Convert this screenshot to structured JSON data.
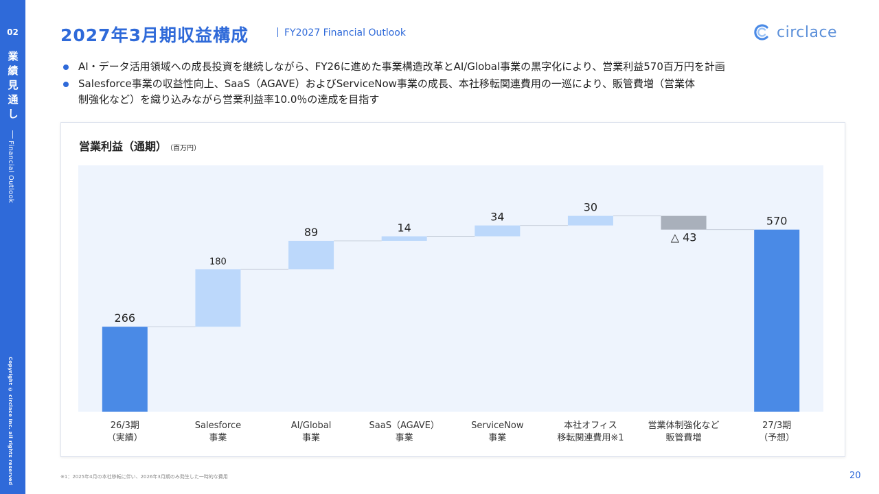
{
  "sidebar": {
    "section_number": "02",
    "section_title": "業績見通し",
    "section_subtitle": "Financial Outlook",
    "copyright": "Copyright © circlace Inc. all rights reserved"
  },
  "header": {
    "title": "2027年3月期収益構成",
    "subtitle": "FY2027 Financial Outlook",
    "logo_text": "circlace"
  },
  "bullets": [
    "AI・データ活用領域への成長投資を継続しながら、FY26に進めた事業構造改革とAI/Global事業の黒字化により、営業利益570百万円を計画",
    "Salesforce事業の収益性向上、SaaS（AGAVE）およびServiceNow事業の成長、本社移転関連費用の一巡により、販管費増（営業体制強化など）を織り込みながら営業利益率10.0％の達成を目指す"
  ],
  "chart_title": "営業利益（通期）",
  "chart_unit": "（百万円）",
  "chart_data": {
    "type": "waterfall",
    "categories": [
      [
        "26/3期",
        "（実績）"
      ],
      [
        "Salesforce",
        "事業"
      ],
      [
        "AI/Global",
        "事業"
      ],
      [
        "SaaS（AGAVE）",
        "事業"
      ],
      [
        "ServiceNow",
        "事業"
      ],
      [
        "本社オフィス",
        "移転関連費用※1"
      ],
      [
        "営業体制強化など",
        "販管費増"
      ],
      [
        "27/3期",
        "（予想）"
      ]
    ],
    "values": [
      266,
      180,
      89,
      14,
      34,
      30,
      -43,
      570
    ],
    "labels": [
      "266",
      "180",
      "89",
      "14",
      "34",
      "30",
      "△ 43",
      "570"
    ],
    "kinds": [
      "total",
      "increase",
      "increase",
      "increase",
      "increase",
      "increase",
      "decrease",
      "total"
    ],
    "colors": {
      "total": "#4a8ae6",
      "increase": "#bcd8fb",
      "decrease": "#a9b0bb",
      "plot_bg": "#eef4fd",
      "connector": "#c8d0dc"
    },
    "ylim": [
      0,
      700
    ]
  },
  "footnote": "※1：2025年4月の本社移転に伴い、2026年3月期のみ発生した一時的な費用",
  "page_number": "20"
}
